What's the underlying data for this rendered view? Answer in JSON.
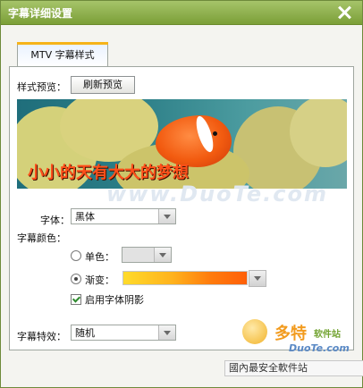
{
  "window": {
    "title": "字幕详细设置"
  },
  "tabs": [
    {
      "label": "MTV 字幕样式"
    }
  ],
  "preview": {
    "label": "样式预览：",
    "refresh_button": "刷新预览",
    "sample_text": "小小的天有大大的梦想",
    "watermark": "www.DuoTe.com"
  },
  "font": {
    "label": "字体：",
    "value": "黑体"
  },
  "subtitle_color": {
    "label": "字幕颜色：",
    "single_label": "单色：",
    "gradient_label": "渐变：",
    "selected": "gradient",
    "gradient_colors": [
      "#ffdb2b",
      "#ff5f08"
    ]
  },
  "shadow": {
    "label": "启用字体阴影",
    "checked": true
  },
  "effect": {
    "label": "字幕特效：",
    "value": "随机"
  },
  "brand": {
    "logo": "多特",
    "logo_suffix": "软件站",
    "site": "DuoTe.com"
  },
  "footer": {
    "text": "國內最安全軟件站"
  },
  "icons": {
    "close": "close-icon"
  }
}
